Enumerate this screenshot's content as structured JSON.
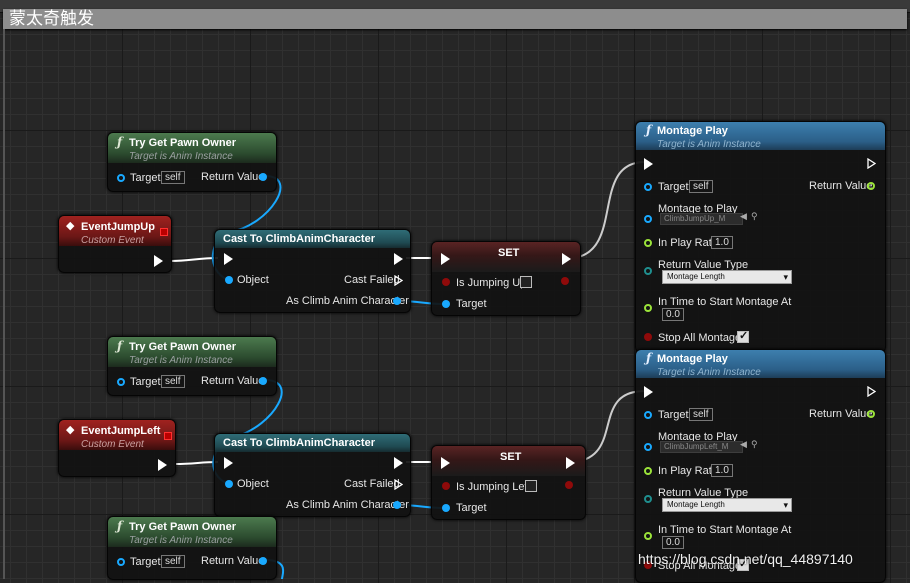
{
  "comment": {
    "title": "蒙太奇触发"
  },
  "get_pawn": {
    "title": "Try Get Pawn Owner",
    "subtitle": "Target is Anim Instance",
    "pin_target": "Target",
    "self": "self",
    "pin_return": "Return Value"
  },
  "events": [
    {
      "title": "EventJumpUp",
      "subtitle": "Custom Event"
    },
    {
      "title": "EventJumpLeft",
      "subtitle": "Custom Event"
    }
  ],
  "cast": {
    "title": "Cast To ClimbAnimCharacter",
    "pin_object": "Object",
    "pin_failed": "Cast Failed",
    "pin_as": "As Climb Anim Character"
  },
  "set": {
    "title": "SET",
    "pin_target": "Target",
    "vars": [
      "Is Jumping Up",
      "Is Jumping Left"
    ]
  },
  "montage": {
    "title": "Montage Play",
    "subtitle": "Target is Anim Instance",
    "target": "Target",
    "self": "self",
    "return_value": "Return Value",
    "montage_to_play": "Montage to Play",
    "assets": [
      "ClimbJumpUp_M",
      "ClimbJumpLeft_M"
    ],
    "in_play_rate": "In Play Rate",
    "play_rate": "1.0",
    "return_value_type": "Return Value Type",
    "type_option": "Montage Length",
    "in_time": "In Time to Start Montage At",
    "time_value": "0.0",
    "stop_all": "Stop All Montages",
    "stop_all_checked": true
  },
  "watermark": "https://blog.csdn.net/qq_44897140",
  "colors": {
    "exec": "#ffffff",
    "object_pin": "#19a9ff",
    "float_pin": "#9be33a",
    "bool_pin": "#8f0a0a",
    "byte_pin": "#1f8f8f",
    "function_header": "#4c7a4e",
    "event_header": "#a0221f"
  }
}
